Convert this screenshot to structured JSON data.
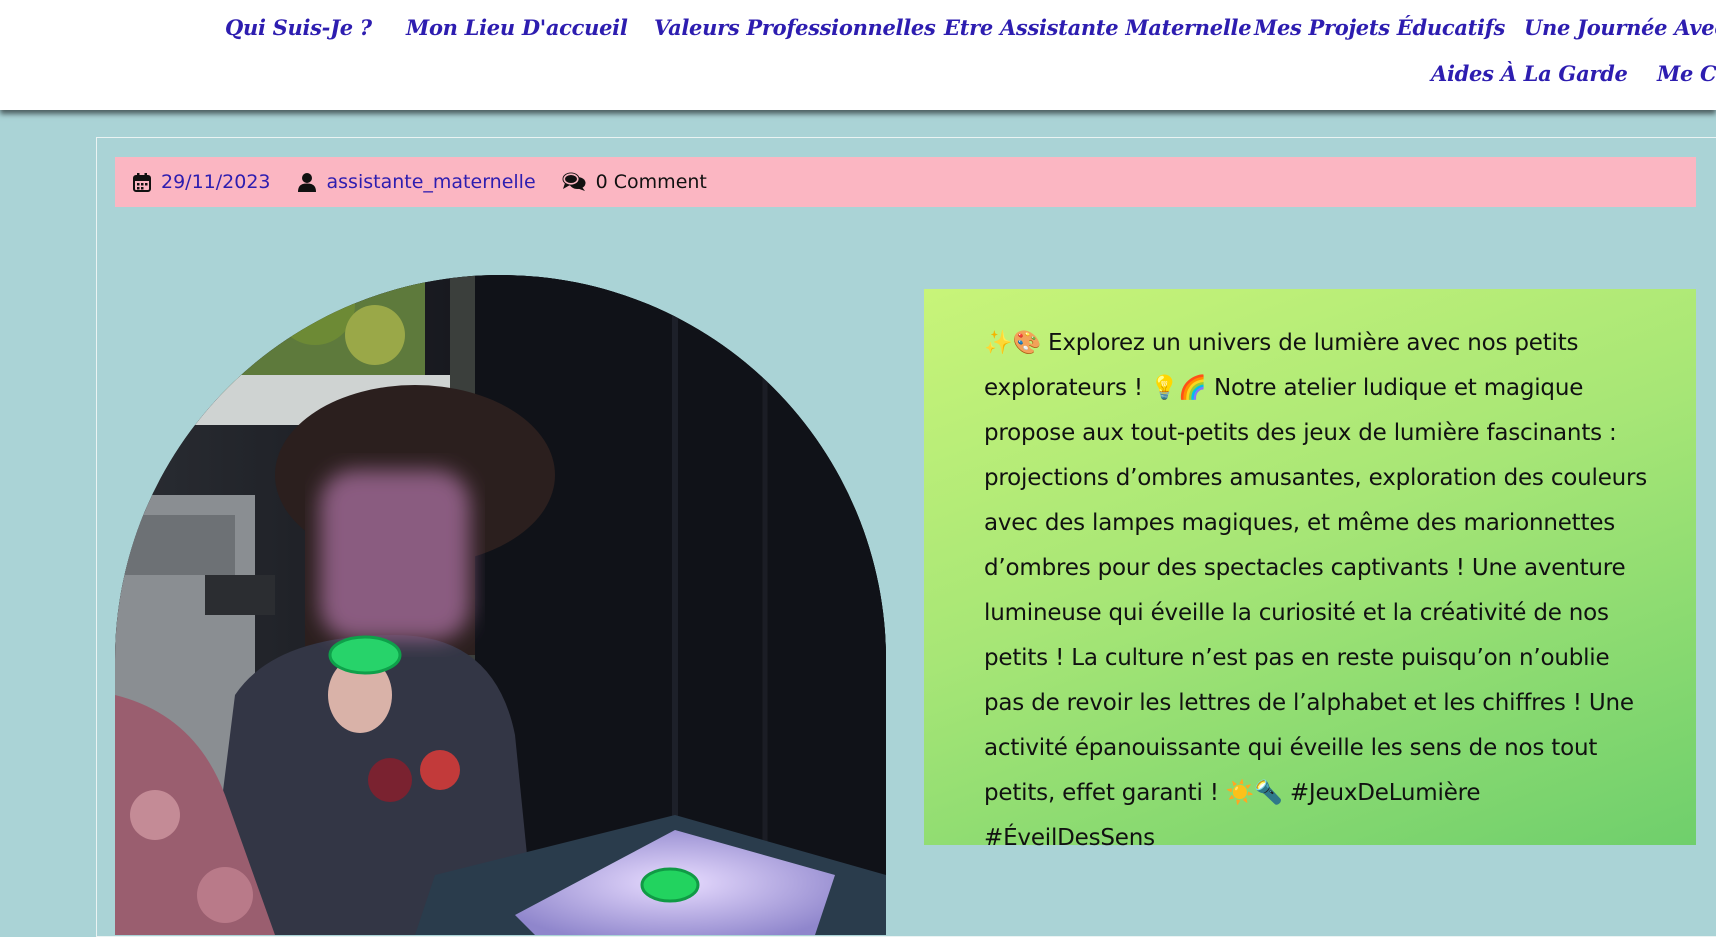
{
  "nav": {
    "row1": [
      "Qui Suis-Je ?",
      "Mon Lieu D'accueil",
      "Valeurs Professionnelles",
      "Etre Assistante Maternelle",
      "Mes Projets Éducatifs",
      "Une Journée Avec C"
    ],
    "row2": [
      "Aides À La Garde",
      "Me Co"
    ]
  },
  "post": {
    "date": "29/11/2023",
    "author": "assistante_maternelle",
    "comments": "0 Comment",
    "body": "✨🎨 Explorez un univers de lumière avec nos petits explorateurs ! 💡🌈 Notre atelier ludique et magique propose aux tout-petits des jeux de lumière fascinants : projections d’ombres amusantes, exploration des couleurs avec des lampes magiques, et même des marionnettes d’ombres pour des spectacles captivants ! Une aventure lumineuse qui éveille la curiosité et la créativité de nos petits ! La culture n’est pas en reste puisqu’on n’oublie pas de revoir les lettres de l’alphabet et les chiffres ! Une activité épanouissante qui éveille les sens de nos tout petits, effet garanti ! ☀️🔦 #JeuxDeLumière #ÉveilDesSens"
  },
  "colors": {
    "page_bg": "#aad3d6",
    "nav_text": "#2d1db0",
    "meta_bg": "#fbb6c2",
    "card_gradient_start": "#c8f479",
    "card_gradient_end": "#6fcf6c"
  },
  "icons": {
    "date": "calendar-icon",
    "author": "user-icon",
    "comments": "comments-icon"
  }
}
